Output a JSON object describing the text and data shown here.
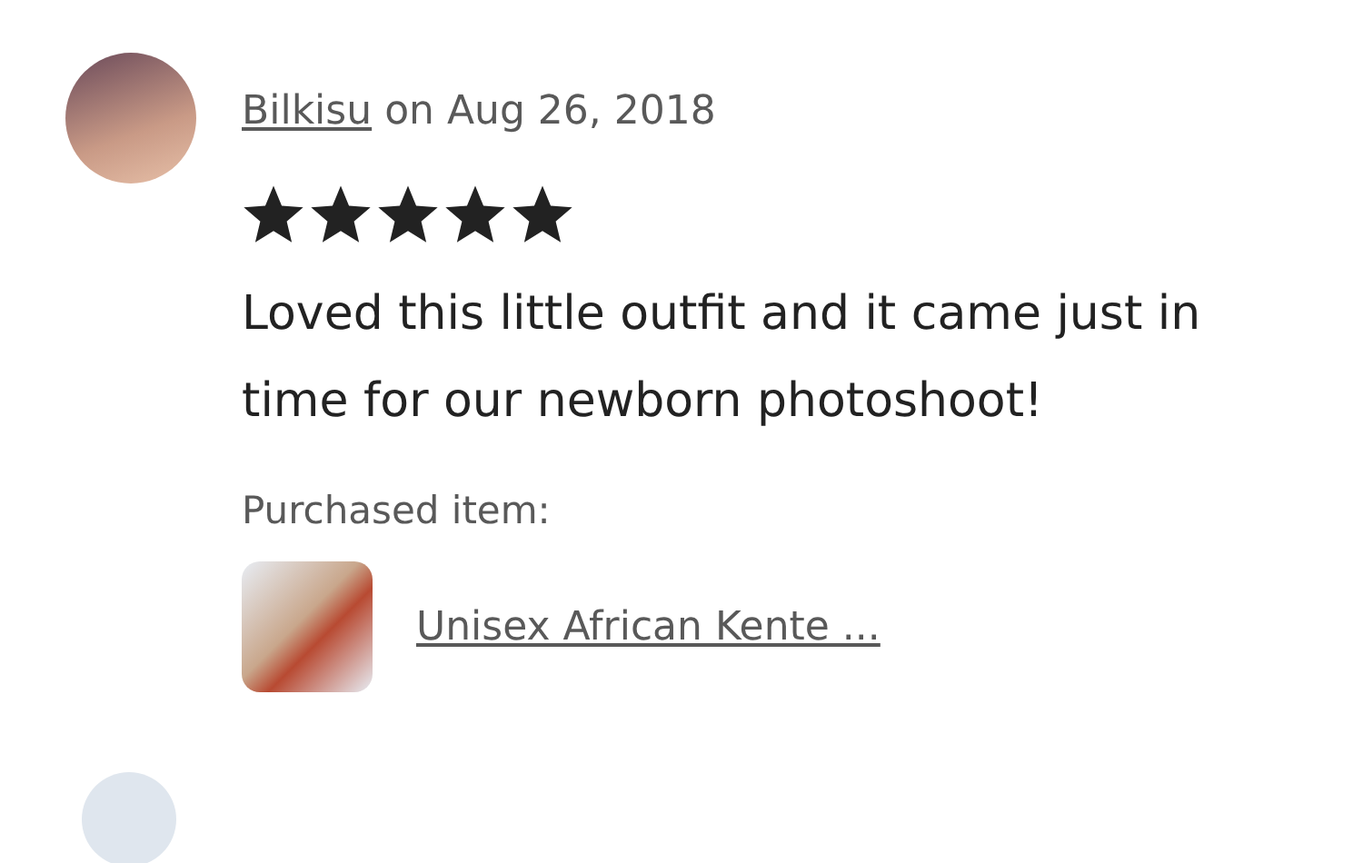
{
  "review": {
    "author": "Bilkisu",
    "date_text": "on Aug 26, 2018",
    "stars": 5,
    "text": "Loved this little outfit and it came just in time for our newborn photoshoot!",
    "purchased_label": "Purchased item:",
    "item_title": "Unisex African Kente ..."
  }
}
